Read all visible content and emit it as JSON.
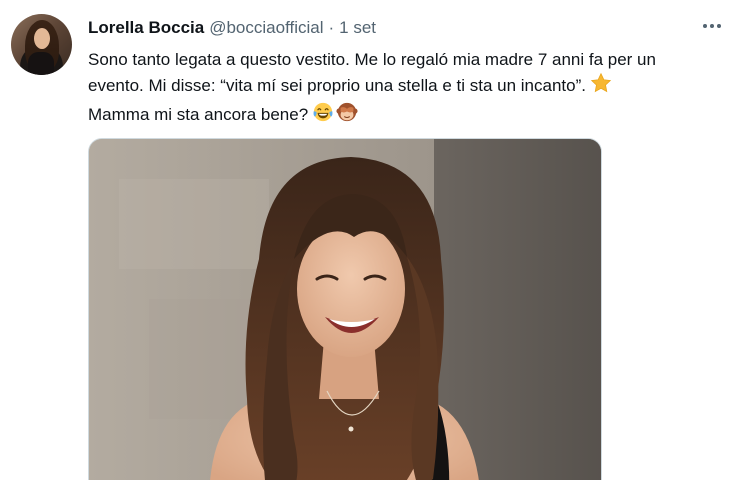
{
  "tweet": {
    "author_name": "Lorella Boccia",
    "handle": "@bocciaofficial",
    "separator": "·",
    "time": "1 set",
    "text_line1": "Sono tanto legata a questo vestito. Me lo regaló mia madre 7 anni fa per un",
    "text_line2": "evento. Mi disse: “vita mí sei proprio una stella e ti sta un incanto”.",
    "text_line3": "Mamma mi sta ancora bene?",
    "emojis": [
      "star-emoji",
      "tears-of-joy-emoji",
      "see-no-evil-monkey-emoji"
    ]
  },
  "colors": {
    "text": "#0f1419",
    "secondary": "#536471",
    "border": "#cfd9de",
    "star": "#f7b731"
  }
}
